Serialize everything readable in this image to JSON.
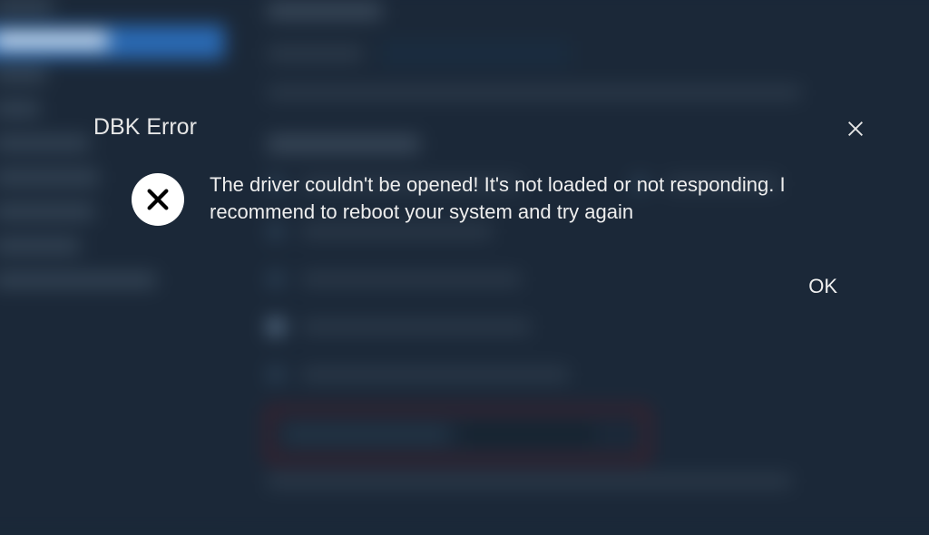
{
  "dialog": {
    "title": "DBK Error",
    "message": "The driver couldn't be opened! It's not loaded or not responding. I recommend to reboot your system and try again",
    "ok_label": "OK"
  }
}
